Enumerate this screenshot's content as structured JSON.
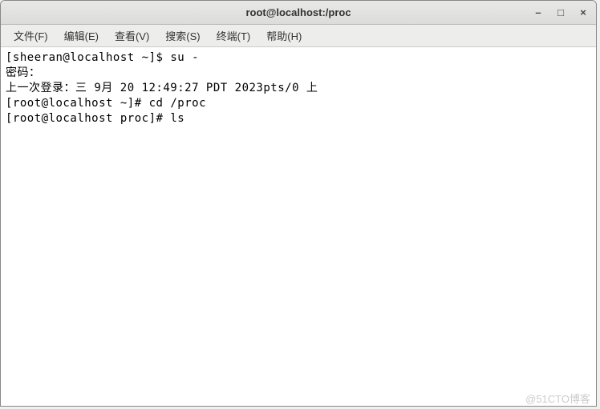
{
  "window": {
    "title": "root@localhost:/proc"
  },
  "controls": {
    "minimize": "–",
    "maximize": "□",
    "close": "×"
  },
  "menu": {
    "file": "文件(F)",
    "edit": "编辑(E)",
    "view": "查看(V)",
    "search": "搜索(S)",
    "terminal": "终端(T)",
    "help": "帮助(H)"
  },
  "terminal": {
    "line1": "[sheeran@localhost ~]$ su -",
    "line2": "密码：",
    "line3": "上一次登录：三 9月 20 12:49:27 PDT 2023pts/0 上",
    "line4": "[root@localhost ~]# cd /proc",
    "line5": "[root@localhost proc]# ls"
  },
  "watermark": "@51CTO博客"
}
